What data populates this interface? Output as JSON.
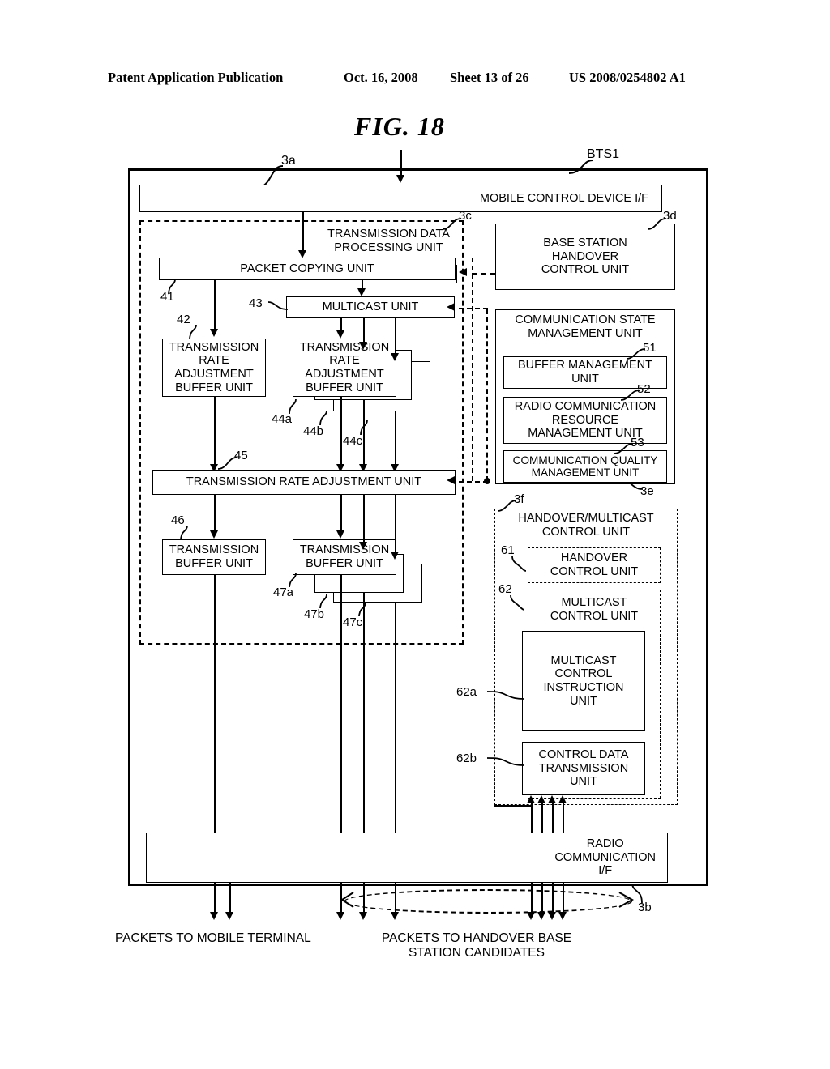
{
  "header": {
    "publication": "Patent Application Publication",
    "date": "Oct. 16, 2008",
    "sheet": "Sheet 13 of 26",
    "number": "US 2008/0254802 A1"
  },
  "figure": {
    "title": "FIG. 18"
  },
  "diagram": {
    "outer_ref": "BTS1",
    "blocks": {
      "mobile_control_if": "MOBILE CONTROL DEVICE I/F",
      "transmission_data_processing": "TRANSMISSION DATA\nPROCESSING UNIT",
      "transmission_data_processing_l1": "TRANSMISSION DATA",
      "transmission_data_processing_l2": "PROCESSING UNIT",
      "packet_copying": "PACKET COPYING UNIT",
      "multicast_unit": "MULTICAST UNIT",
      "rate_buffer_left": "TRANSMISSION\nRATE\nADJUSTMENT\nBUFFER UNIT",
      "rate_buffer_right": "TRANSMISSION\nRATE\nADJUSTMENT\nBUFFER UNIT",
      "rate_adjustment": "TRANSMISSION RATE ADJUSTMENT UNIT",
      "tx_buffer_left": "TRANSMISSION\nBUFFER UNIT",
      "tx_buffer_right": "TRANSMISSION\nBUFFER UNIT",
      "base_station_handover": "BASE STATION\nHANDOVER\nCONTROL UNIT",
      "comm_state_mgmt": "COMMUNICATION STATE\nMANAGEMENT UNIT",
      "comm_state_mgmt_l1": "COMMUNICATION STATE",
      "comm_state_mgmt_l2": "MANAGEMENT UNIT",
      "buffer_mgmt": "BUFFER MANAGEMENT\nUNIT",
      "radio_resource_mgmt": "RADIO COMMUNICATION\nRESOURCE\nMANAGEMENT UNIT",
      "comm_quality_mgmt": "COMMUNICATION QUALITY\nMANAGEMENT UNIT",
      "handover_multicast_ctrl": "HANDOVER/MULTICAST\nCONTROL UNIT",
      "handover_multicast_ctrl_l1": "HANDOVER/MULTICAST",
      "handover_multicast_ctrl_l2": "CONTROL UNIT",
      "handover_ctrl": "HANDOVER\nCONTROL UNIT",
      "multicast_ctrl": "MULTICAST\nCONTROL UNIT",
      "multicast_ctrl_l1": "MULTICAST",
      "multicast_ctrl_l2": "CONTROL UNIT",
      "multicast_ctrl_instruction": "MULTICAST\nCONTROL\nINSTRUCTION\nUNIT",
      "control_data_transmission": "CONTROL DATA\nTRANSMISSION\nUNIT",
      "radio_comm_if": "RADIO\nCOMMUNICATION\nI/F"
    },
    "refs": {
      "r3a": "3a",
      "r3b": "3b",
      "r3c": "3c",
      "r3d": "3d",
      "r3e": "3e",
      "r3f": "3f",
      "r41": "41",
      "r42": "42",
      "r43": "43",
      "r44a": "44a",
      "r44b": "44b",
      "r44c": "44c",
      "r45": "45",
      "r46": "46",
      "r47a": "47a",
      "r47b": "47b",
      "r47c": "47c",
      "r51": "51",
      "r52": "52",
      "r53": "53",
      "r61": "61",
      "r62": "62",
      "r62a": "62a",
      "r62b": "62b"
    },
    "captions": {
      "to_mobile_terminal": "PACKETS TO MOBILE TERMINAL",
      "to_handover_candidates": "PACKETS TO HANDOVER BASE\nSTATION CANDIDATES",
      "to_handover_candidates_l1": "PACKETS TO HANDOVER BASE",
      "to_handover_candidates_l2": "STATION CANDIDATES"
    }
  }
}
